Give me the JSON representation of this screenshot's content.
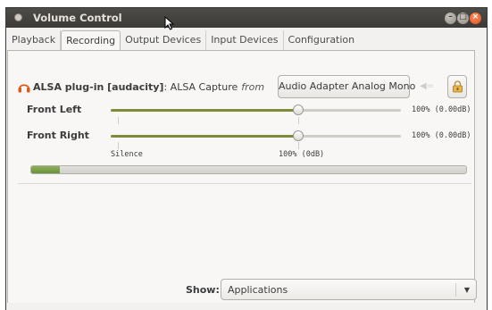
{
  "window": {
    "title": "Volume Control"
  },
  "tabs": [
    {
      "label": "Playback",
      "active": false
    },
    {
      "label": "Recording",
      "active": true
    },
    {
      "label": "Output Devices",
      "active": false
    },
    {
      "label": "Input Devices",
      "active": false
    },
    {
      "label": "Configuration",
      "active": false
    }
  ],
  "stream": {
    "name": "ALSA plug-in [audacity]",
    "description": ": ALSA Capture",
    "from_text": "from",
    "device_button": "Audio Adapter Analog Mono",
    "icon": "headphones-icon",
    "mute_icon": "speaker-mute-icon",
    "lock_icon": "lock-channels-icon"
  },
  "channels": [
    {
      "label": "Front Left",
      "value_text": "100% (0.00dB)",
      "level_percent": 100
    },
    {
      "label": "Front Right",
      "value_text": "100% (0.00dB)",
      "level_percent": 100
    }
  ],
  "scale": {
    "silence": "Silence",
    "hundred": "100% (0dB)"
  },
  "level_meter": {
    "fraction": 0.065
  },
  "footer": {
    "show_label": "Show:",
    "show_value": "Applications"
  },
  "colors": {
    "slider_fill": "#7e8c3a",
    "meter_fill": "#5e8a33",
    "close_button": "#e0501e",
    "headphones": "#d95b1a"
  }
}
